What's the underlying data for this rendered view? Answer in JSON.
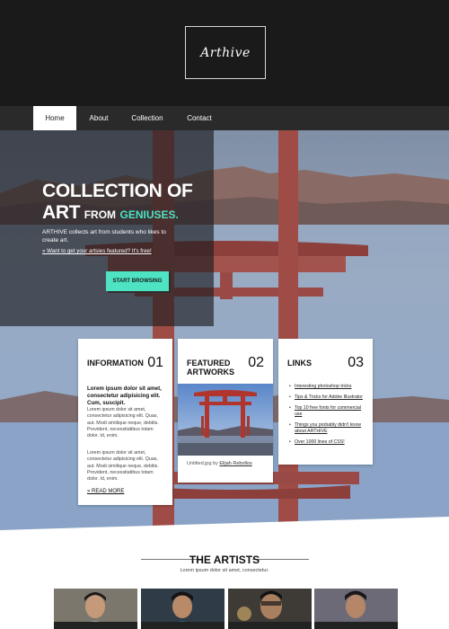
{
  "brand": {
    "logo": "Arthive"
  },
  "nav": {
    "items": [
      "Home",
      "About",
      "Collection",
      "Contact"
    ],
    "active_index": 0
  },
  "hero": {
    "title_line1": "COLLECTION OF",
    "title_art": "ART",
    "title_from": "FROM",
    "title_accent": "GENIUSES.",
    "description": "ARTHIVE collects art from students who likes to create art.",
    "link": "Want to get your artsies featured? It's free!",
    "cta": "START BROWSING"
  },
  "cards": {
    "information": {
      "title": "INFORMATION",
      "number": "01",
      "lead": "Lorem ipsum dolor sit amet, consectetur adipisicing elit. Cum, suscipit.",
      "body1": "Lorem ipsum dolor sit amet, consectetur adipisicing elit. Quas, aut. Modi similique neque, debitis. Provident, necessitatibus totam dolor. Id, enim.",
      "body2": "Lorem ipsum dolor sit amet, consectetur adipisicing elit. Quas, aut. Modi similique neque, debitis. Provident, necessitatibus totam dolor. Id, enim.",
      "read_more": "READ MORE"
    },
    "featured": {
      "title_line1": "FEATURED",
      "title_line2": "ARTWORKS",
      "number": "02",
      "caption": "Untitled.jpg by",
      "author": "Elijah Rebollos"
    },
    "links": {
      "title": "LINKS",
      "number": "03",
      "items": [
        "Interesting photoshop tricks",
        "Tips & Tricks for Adobe Illustrator",
        "Top 10 free fonts for commercial use",
        "Things you probably didn't know about ARTHIVE",
        "Over 1000 lines of CSS!"
      ]
    }
  },
  "artists": {
    "title": "THE ARTISTS",
    "subtitle": "Lorem ipsum dolor sit amet, consectetur."
  },
  "colors": {
    "accent": "#4de3c3",
    "header_bg": "#1b1a1b",
    "nav_bg": "#2a2a2b"
  }
}
